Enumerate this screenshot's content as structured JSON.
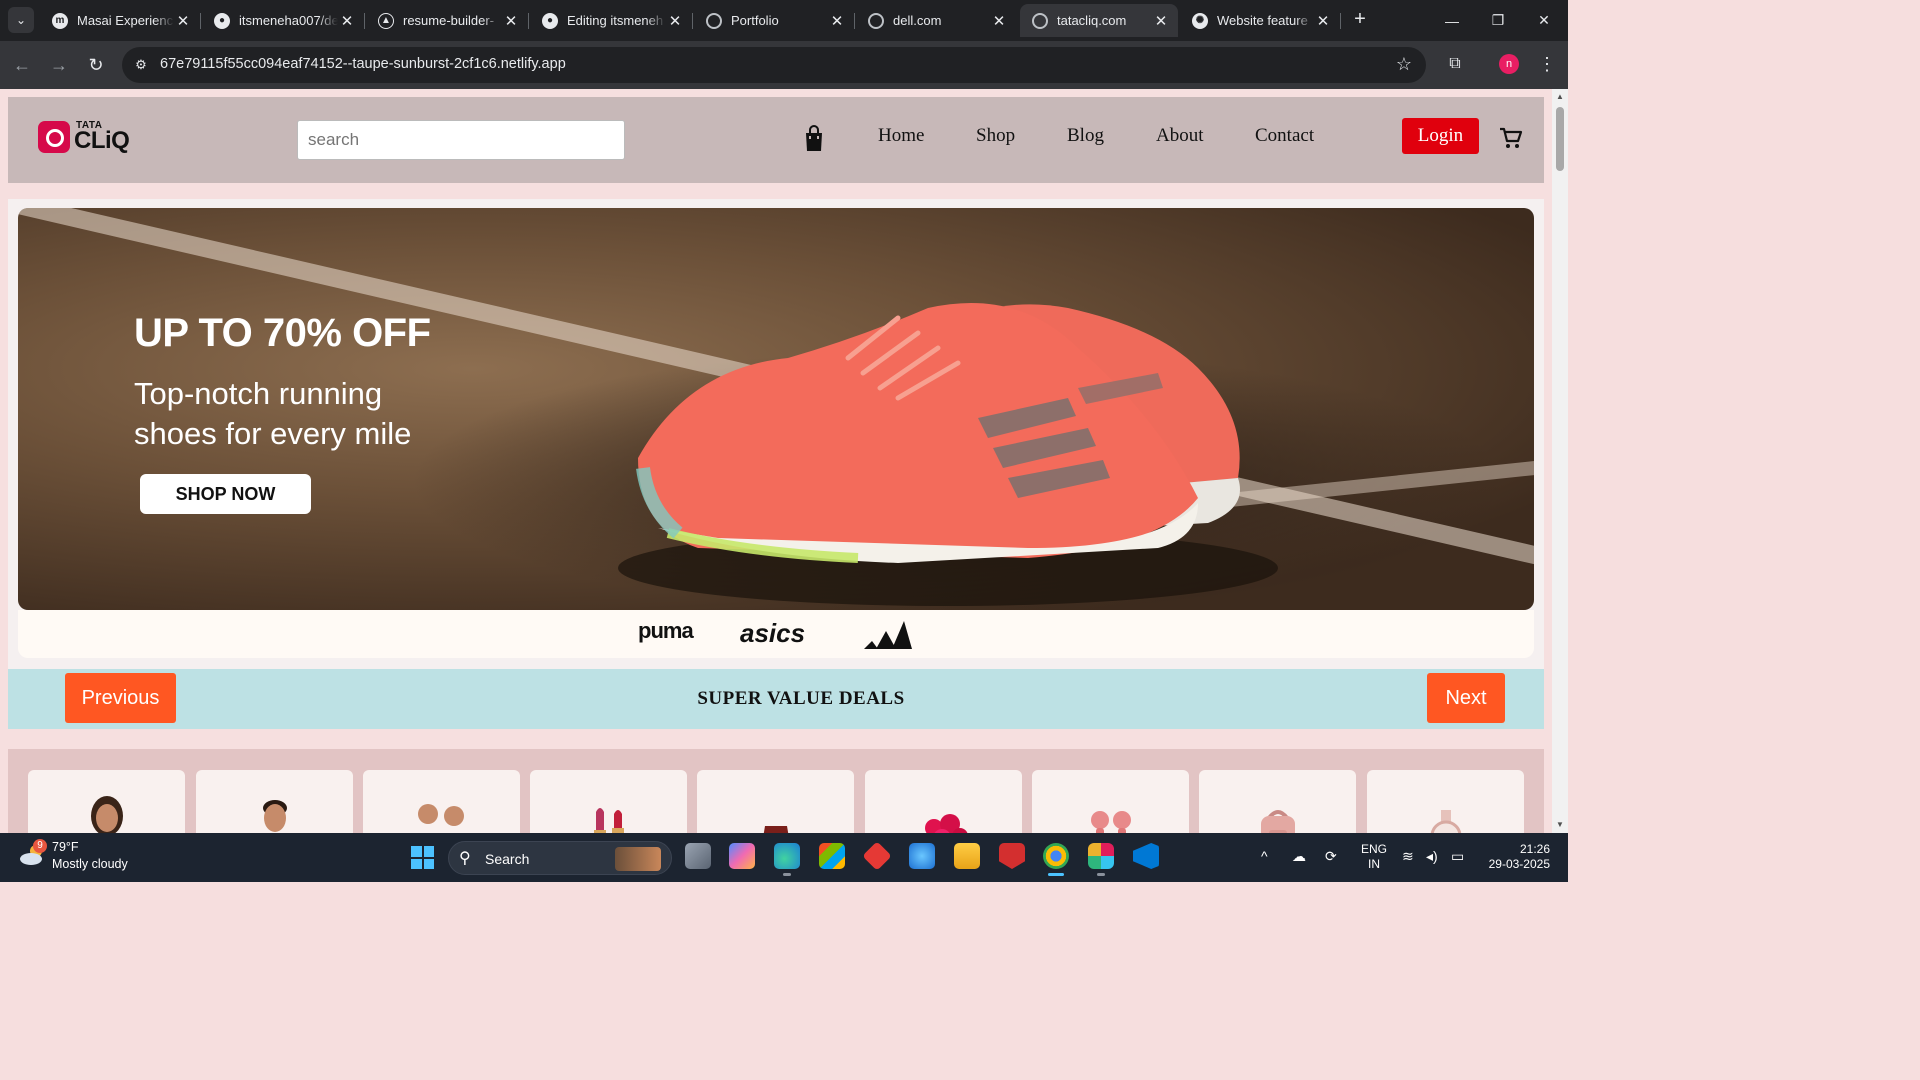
{
  "browser": {
    "tabs": [
      {
        "label": "Masai Experience",
        "icon": "masai-icon",
        "active": false
      },
      {
        "label": "itsmeneha007/de",
        "icon": "github-icon",
        "active": false
      },
      {
        "label": "resume-builder-",
        "icon": "vercel-icon",
        "active": false
      },
      {
        "label": "Editing itsmeneh",
        "icon": "github-icon",
        "active": false
      },
      {
        "label": "Portfolio",
        "icon": "globe-icon",
        "active": false
      },
      {
        "label": "dell.com",
        "icon": "globe-icon",
        "active": false
      },
      {
        "label": "tatacliq.com",
        "icon": "globe-icon",
        "active": true
      },
      {
        "label": "Website feature",
        "icon": "openai-icon",
        "active": false
      }
    ],
    "url": "67e79115f55cc094eaf74152--taupe-sunburst-2cf1c6.netlify.app",
    "profile_initial": "n"
  },
  "site": {
    "logo_top": "TATA",
    "logo_bottom": "CLiQ",
    "search_placeholder": "search",
    "nav": [
      "Home",
      "Shop",
      "Blog",
      "About",
      "Contact"
    ],
    "login_label": "Login",
    "banner": {
      "headline": "UP TO 70% OFF",
      "subline": "Top-notch running shoes for every mile",
      "cta": "SHOP NOW",
      "brands": [
        "puma",
        "asics",
        "adidas"
      ]
    },
    "deals": {
      "prev_label": "Previous",
      "title": "SUPER VALUE DEALS",
      "next_label": "Next"
    },
    "product_categories": [
      "women",
      "men",
      "kids",
      "lipstick",
      "hat",
      "flowers",
      "earbuds",
      "backpack",
      "watch"
    ]
  },
  "colors": {
    "header_bg": "#c7b8b8",
    "login_red": "#e0000d",
    "deal_button_orange": "#ff5722",
    "deals_bar_bg": "#bde1e4",
    "brand_pink": "#d6094a"
  },
  "taskbar": {
    "weather_badge": "9",
    "temperature": "79°F",
    "condition": "Mostly cloudy",
    "search_label": "Search",
    "language_line1": "ENG",
    "language_line2": "IN",
    "time": "21:26",
    "date": "29-03-2025"
  }
}
